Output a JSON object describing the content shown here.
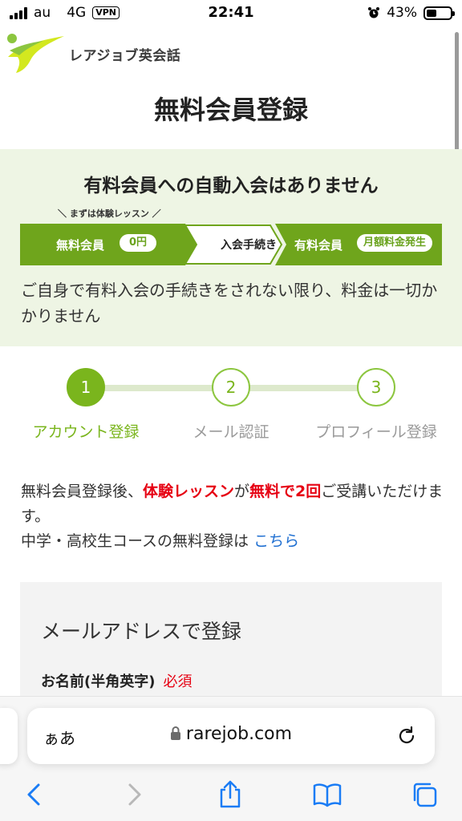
{
  "status_bar": {
    "carrier": "au",
    "network": "4G",
    "vpn": "VPN",
    "time": "22:41",
    "battery": "43%",
    "battery_level": 0.43
  },
  "logo": {
    "text": "レアジョブ英会話"
  },
  "page_title": "無料会員登録",
  "notice": {
    "title": "有料会員への自動入会はありません",
    "caption": "＼ まずは体験レッスン ／",
    "flow": {
      "step1_label": "無料会員",
      "step1_badge": "0円",
      "step2_label": "入会手続き",
      "step3_label": "有料会員",
      "step3_badge": "月額料金発生"
    },
    "body": "ご自身で有料入会の手続きをされない限り、料金は一切かかりません"
  },
  "steps": [
    {
      "number": "1",
      "label": "アカウント登録",
      "state": "active"
    },
    {
      "number": "2",
      "label": "メール認証",
      "state": "inactive"
    },
    {
      "number": "3",
      "label": "プロフィール登録",
      "state": "inactive"
    }
  ],
  "intro": {
    "part1": "無料会員登録後、",
    "trial": "体験レッスン",
    "part2": "が",
    "free_twice": "無料で2回",
    "part3": "ご受講いただけます。",
    "line2": "中学・高校生コースの無料登録は",
    "link": "こちら"
  },
  "form": {
    "heading": "メールアドレスで登録",
    "name_label": "お名前(半角英字)",
    "required": "必須"
  },
  "browser": {
    "aa": "ぁあ",
    "url": "rarejob.com"
  },
  "colors": {
    "brand_green": "#7ab51d",
    "notice_bg": "#eef5e4",
    "accent_red": "#e60012",
    "link_blue": "#1f6fd1",
    "ios_blue": "#1a7cf5"
  }
}
